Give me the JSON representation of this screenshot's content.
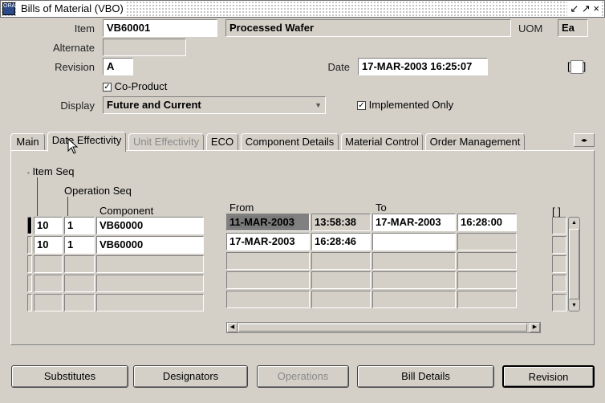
{
  "window": {
    "title": "Bills of Material (VBO)",
    "title_buttons": "↙ ↗ ×"
  },
  "header": {
    "item_label": "Item",
    "item_value": "VB60001",
    "item_desc": "Processed Wafer",
    "uom_label": "UOM",
    "uom_value": "Ea",
    "alternate_label": "Alternate",
    "alternate_value": "",
    "revision_label": "Revision",
    "revision_value": "A",
    "date_label": "Date",
    "date_value": "17-MAR-2003 16:25:07",
    "flex_field": "[ ]",
    "coproduct_label": "Co-Product",
    "display_label": "Display",
    "display_value": "Future and Current",
    "implemented_label": "Implemented Only"
  },
  "tabs": [
    {
      "label": "Main"
    },
    {
      "label": "Date Effectivity"
    },
    {
      "label": "Unit Effectivity"
    },
    {
      "label": "ECO"
    },
    {
      "label": "Component Details"
    },
    {
      "label": "Material Control"
    },
    {
      "label": "Order Management"
    }
  ],
  "grid": {
    "item_seq_header": "Item Seq",
    "op_seq_header": "Operation Seq",
    "component_header": "Component",
    "from_header": "From",
    "to_header": "To",
    "flex_header": "[ ]",
    "rows": [
      {
        "item_seq": "10",
        "op_seq": "1",
        "component": "VB60000",
        "from_date": "11-MAR-2003",
        "from_time": "13:58:38",
        "to_date": "17-MAR-2003",
        "to_time": "16:28:00"
      },
      {
        "item_seq": "10",
        "op_seq": "1",
        "component": "VB60000",
        "from_date": "17-MAR-2003",
        "from_time": "16:28:46",
        "to_date": "",
        "to_time": ""
      }
    ]
  },
  "buttons": {
    "substitutes": "Substitutes",
    "designators": "Designators",
    "operations": "Operations",
    "bill_details": "Bill Details",
    "revision": "Revision"
  }
}
